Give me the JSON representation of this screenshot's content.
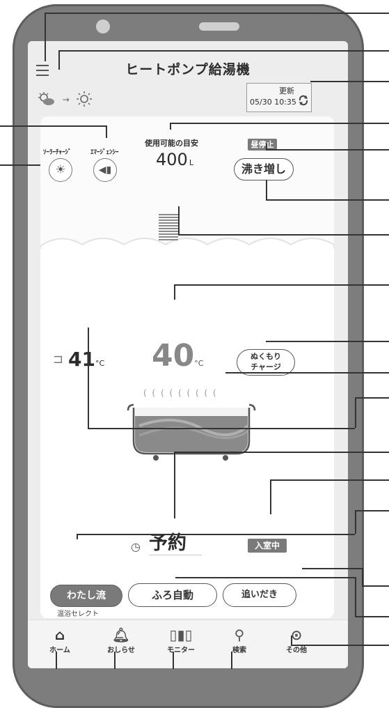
{
  "header": {
    "title": "ヒートポンプ給湯機"
  },
  "weather": {
    "from_icon": "cloud-sun-icon",
    "arrow": "→",
    "to_icon": "sun-icon"
  },
  "update": {
    "label": "更新",
    "datetime": "05/30 10:35"
  },
  "charge_modes": {
    "solar_label": "ｿｰﾗｰﾁｬｰｼﾞ",
    "emergency_label": "ｴﾏｰｼﾞｪﾝｼｰ"
  },
  "tank": {
    "label": "使用可能の目安",
    "value": "400",
    "unit": "L",
    "status_badge": "昼停止",
    "boost_button": "沸き増し"
  },
  "bath": {
    "faucet_temp": "41",
    "bath_temp": "40",
    "temp_unit": "°C",
    "warmth_button_line1": "ぬくもり",
    "warmth_button_line2": "チャージ",
    "steam": "( ( ( ( ( ( ( ( ("
  },
  "reserve": {
    "label": "予約",
    "occupancy_badge": "入室中"
  },
  "controls": {
    "my_style": "わたし流",
    "my_style_sub": "温浴セレクト",
    "auto_bath": "ふろ自動",
    "reheat": "追いだき"
  },
  "tabs": [
    {
      "label": "ホーム",
      "icon": "home-icon"
    },
    {
      "label": "おしらせ",
      "icon": "bell-icon"
    },
    {
      "label": "モニター",
      "icon": "bar-chart-icon"
    },
    {
      "label": "検索",
      "icon": "search-icon"
    },
    {
      "label": "その他",
      "icon": "more-icon"
    }
  ],
  "colors": {
    "frame": "#7d7d7d",
    "screen": "#ededed",
    "badge": "#7a7a7a",
    "active_tab_button": "#7a7a7a"
  }
}
